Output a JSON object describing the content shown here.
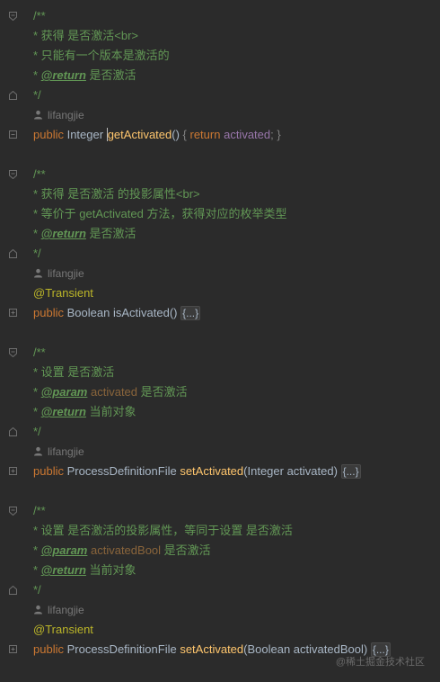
{
  "blocks": [
    {
      "doc_open": "/**",
      "doc_lines": [
        {
          "prefix": " * ",
          "text": "获得 是否激活<br>"
        },
        {
          "prefix": " * ",
          "text": "只能有一个版本是激活的"
        },
        {
          "prefix": " * ",
          "tag": "@return",
          "text": " 是否激活"
        }
      ],
      "doc_close": " */",
      "author": "lifangjie",
      "annotation": "",
      "sig": {
        "modifier": "public",
        "return_type": "Integer",
        "method": "getActivated",
        "params": "()",
        "body_open": " { ",
        "body_kw": "return",
        "body_field": "activated",
        "body_close": "; }"
      }
    },
    {
      "doc_open": "/**",
      "doc_lines": [
        {
          "prefix": " * ",
          "text": "获得 是否激活 的投影属性<br>"
        },
        {
          "prefix": " * ",
          "text": "等价于 getActivated 方法，获得对应的枚举类型"
        },
        {
          "prefix": " * ",
          "tag": "@return",
          "text": " 是否激活"
        }
      ],
      "doc_close": " */",
      "author": "lifangjie",
      "annotation": "@Transient",
      "sig": {
        "modifier": "public",
        "return_type": "Boolean",
        "method": "isActivated",
        "params": "()",
        "folded": "{...}"
      }
    },
    {
      "doc_open": "/**",
      "doc_lines": [
        {
          "prefix": " * ",
          "text": "设置 是否激活"
        },
        {
          "prefix": " * ",
          "tag": "@param",
          "param": " activated",
          "text": " 是否激活"
        },
        {
          "prefix": " * ",
          "tag": "@return",
          "text": " 当前对象"
        }
      ],
      "doc_close": " */",
      "author": "lifangjie",
      "annotation": "",
      "sig": {
        "modifier": "public",
        "return_type": "ProcessDefinitionFile",
        "method": "setActivated",
        "params": "(Integer activated)",
        "folded": "{...}"
      }
    },
    {
      "doc_open": "/**",
      "doc_lines": [
        {
          "prefix": " * ",
          "text": "设置 是否激活的投影属性，等同于设置 是否激活"
        },
        {
          "prefix": " * ",
          "tag": "@param",
          "param": " activatedBool",
          "text": " 是否激活"
        },
        {
          "prefix": " * ",
          "tag": "@return",
          "text": " 当前对象"
        }
      ],
      "doc_close": " */",
      "author": "lifangjie",
      "annotation": "@Transient",
      "sig": {
        "modifier": "public",
        "return_type": "ProcessDefinitionFile",
        "method": "setActivated",
        "params": "(Boolean activatedBool)",
        "folded": "{...}"
      }
    }
  ],
  "watermark": "@稀土掘金技术社区",
  "colors": {
    "background": "#2b2b2b",
    "doc_comment": "#629755",
    "keyword": "#cc7832",
    "method": "#ffc66d",
    "field": "#9876aa",
    "annotation": "#bbb529",
    "param_name": "#8a653b"
  }
}
